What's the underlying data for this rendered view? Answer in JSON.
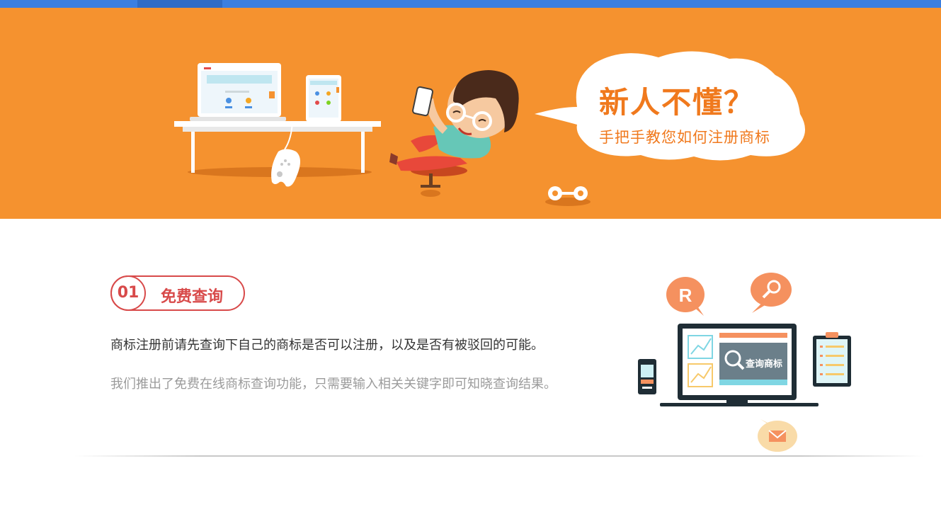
{
  "hero": {
    "bubble_title": "新人不懂？",
    "bubble_subtitle": "手把手教您如何注册商标"
  },
  "step": {
    "number": "01",
    "title": "免费查询",
    "description_primary": "商标注册前请先查询下自己的商标是否可以注册，以及是否有被驳回的可能。",
    "description_secondary": "我们推出了免费在线商标查询功能，只需要输入相关关键字即可知晓查询结果。"
  },
  "illustration": {
    "search_label": "查询商标",
    "registered_mark": "R"
  },
  "colors": {
    "topbar": "#3b7fe0",
    "hero_bg": "#f5922f",
    "accent_red": "#d84a4a",
    "bubble_text": "#f0791d"
  }
}
